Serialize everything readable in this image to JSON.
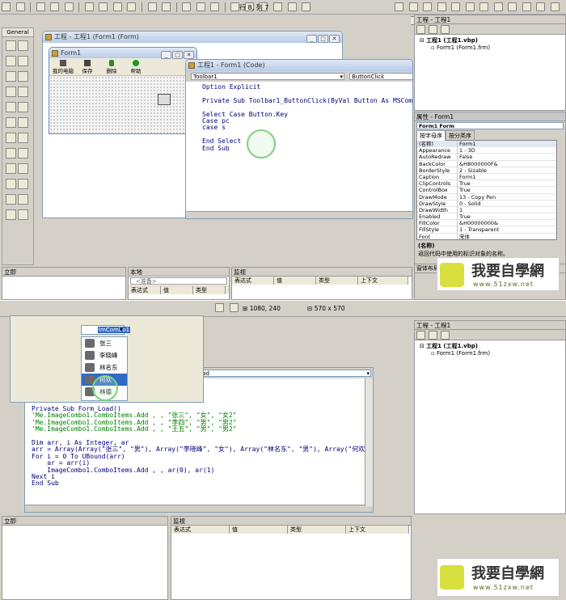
{
  "top": {
    "toolbar": {
      "status": "行 8, 列 7"
    },
    "toolbox": {
      "tab_label": "General"
    },
    "project_window": {
      "title": "工程 - 工程1 (Form1 (Form)"
    },
    "form_window": {
      "title": "Form1",
      "buttons": [
        "我的电脑",
        "保存",
        "删除",
        "帮助"
      ]
    },
    "code_window": {
      "title": "工程1 - Form1 (Code)",
      "object_combo": "Toolbar1",
      "proc_combo": "ButtonClick",
      "lines": [
        "Option Explicit",
        "",
        "Private Sub Toolbar1_ButtonClick(ByVal Button As MSComctlLi",
        "",
        "Select Case Button.Key",
        "Case pc",
        "case s",
        "",
        "End Select",
        "End Sub"
      ]
    },
    "project_explorer": {
      "title": "工程 - 工程1",
      "root": "工程1 (工程1.vbp)",
      "child": "Form1 (Form1.frm)"
    },
    "properties": {
      "title": "属性 - Form1",
      "object": "Form1 Form",
      "tabs": [
        "按字母序",
        "按分类序"
      ],
      "rows": [
        [
          "(名称)",
          "Form1"
        ],
        [
          "Appearance",
          "1 - 3D"
        ],
        [
          "AutoRedraw",
          "False"
        ],
        [
          "BackColor",
          "&H8000000F&"
        ],
        [
          "BorderStyle",
          "2 - Sizable"
        ],
        [
          "Caption",
          "Form1"
        ],
        [
          "ClipControls",
          "True"
        ],
        [
          "ControlBox",
          "True"
        ],
        [
          "DrawMode",
          "13 - Copy Pen"
        ],
        [
          "DrawStyle",
          "0 - Solid"
        ],
        [
          "DrawWidth",
          "1"
        ],
        [
          "Enabled",
          "True"
        ],
        [
          "FillColor",
          "&H00000000&"
        ],
        [
          "FillStyle",
          "1 - Transparent"
        ],
        [
          "Font",
          "宋体"
        ]
      ],
      "desc_title": "(名称)",
      "desc_text": "返回代码中使用的标识对象的名称。"
    },
    "immediate": {
      "title": "立即"
    },
    "locals": {
      "title": "本地",
      "combo": "<准备>",
      "cols": [
        "表达式",
        "值",
        "类型"
      ]
    },
    "watch": {
      "title": "监视",
      "cols": [
        "表达式",
        "值",
        "类型",
        "上下文"
      ]
    },
    "layout_window": {
      "title": "窗体布局"
    }
  },
  "bottom": {
    "toolbar": {
      "position": "1080, 240",
      "size": "570 x 570"
    },
    "combo": {
      "selected": "ImCombo1",
      "items": [
        "张三",
        "李晓峰",
        "林名东",
        "何欢",
        "林德"
      ]
    },
    "code_window": {
      "proc_combo": "load",
      "lines": [
        "Private Sub Form_Load()",
        "'Me.ImageCombo1.ComboItems.Add , , \"张三\", \"女\", \"女2\"",
        "'Me.ImageCombo1.ComboItems.Add , , \"李四\", \"男\", \"男2\"",
        "'Me.ImageCombo1.ComboItems.Add , , \"王五\", \"男\", \"男2\"",
        "",
        "Dim arr, i As Integer, ar",
        "arr = Array(Array(\"张三\", \"男\"), Array(\"李晓峰\", \"女\"), Array(\"林名东\", \"男\"), Array(\"何欢\", \"",
        "For i = 0 To UBound(arr)",
        "    ar = arr(i)",
        "    ImageCombo1.ComboItems.Add , , ar(0), ar(1)",
        "Next i",
        "End Sub"
      ]
    },
    "project_explorer": {
      "title": "工程 - 工程1",
      "root": "工程1 (工程1.vbp)",
      "child": "Form1 (Form1.frm)"
    },
    "immediate": {
      "title": "立即"
    },
    "watch": {
      "title": "监视",
      "cols": [
        "表达式",
        "值",
        "类型",
        "上下文"
      ]
    }
  },
  "logo": {
    "text": "我要自學網",
    "url": "www.51zxw.net"
  }
}
